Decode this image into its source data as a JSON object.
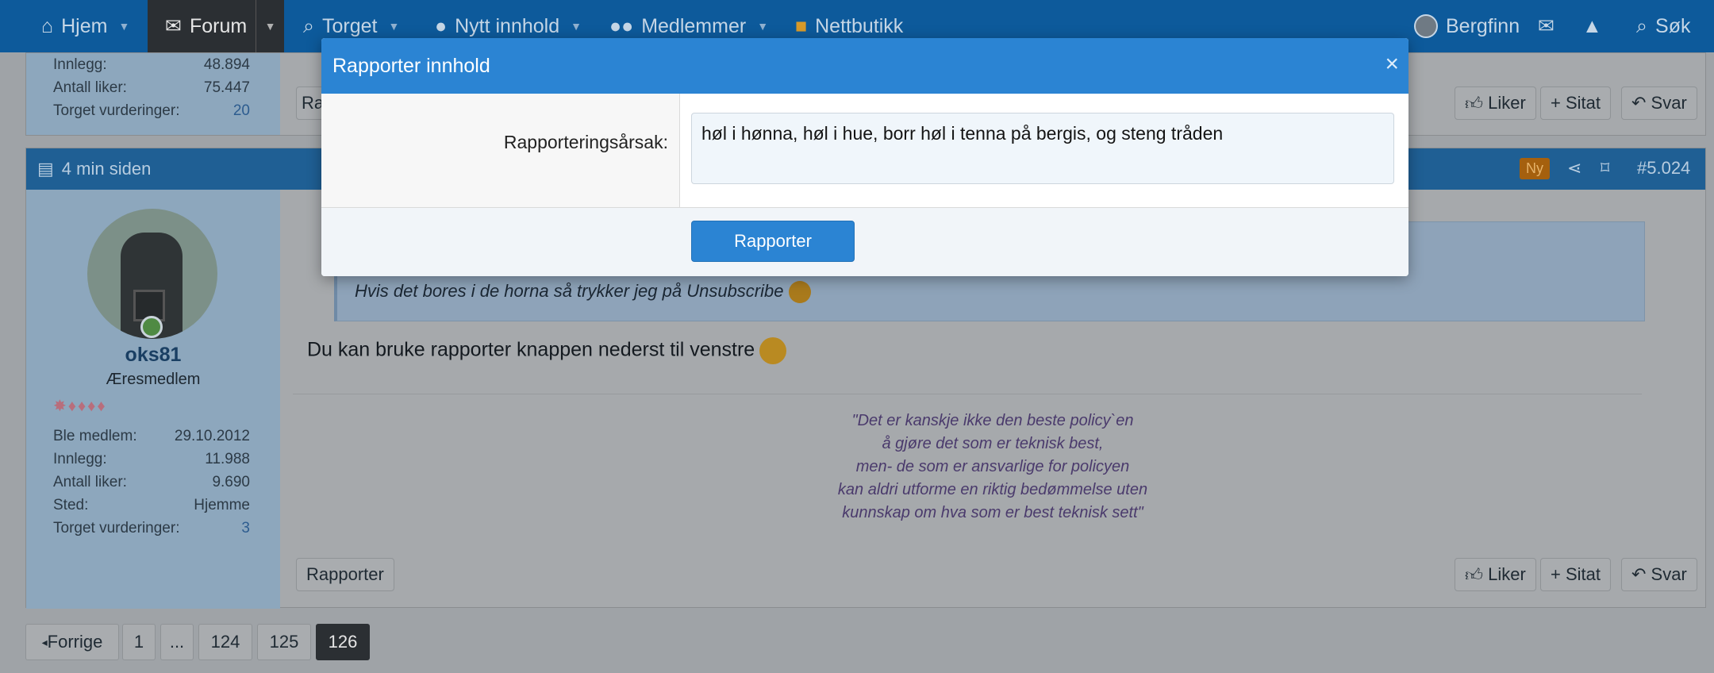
{
  "nav": {
    "home": "Hjem",
    "forum": "Forum",
    "torget": "Torget",
    "new_content": "Nytt innhold",
    "members": "Medlemmer",
    "shop": "Nettbutikk",
    "user": "Bergfinn",
    "search": "Søk"
  },
  "prev_post": {
    "stats": [
      {
        "label": "Innlegg:",
        "value": "48.894"
      },
      {
        "label": "Antall liker:",
        "value": "75.447"
      },
      {
        "label": "Torget vurderinger:",
        "value": "20"
      }
    ],
    "report_label_partial": "Ra",
    "like": "Liker",
    "quote": "Sitat",
    "reply": "Svar"
  },
  "post": {
    "time": "4 min siden",
    "badge_new": "Ny",
    "number": "#5.024",
    "username": "oks81",
    "user_title": "Æresmedlem",
    "stats": [
      {
        "label": "Ble medlem:",
        "value": "29.10.2012"
      },
      {
        "label": "Innlegg:",
        "value": "11.988"
      },
      {
        "label": "Antall liker:",
        "value": "9.690"
      },
      {
        "label": "Sted:",
        "value": "Hjemme"
      },
      {
        "label": "Torget vurderinger:",
        "value": "3"
      }
    ],
    "quote_text": "Hvis det bores i de horna så trykker jeg på Unsubscribe",
    "message": "Du kan bruke rapporter knappen nederst til venstre",
    "signature": [
      "\"Det er kanskje ikke den beste policy`en",
      "å gjøre det som er teknisk best,",
      "men- de som er ansvarlige for policyen",
      "kan aldri utforme en riktig bedømmelse uten",
      "kunnskap om hva som er best teknisk sett\""
    ],
    "report": "Rapporter",
    "like": "Liker",
    "quote": "Sitat",
    "reply": "Svar"
  },
  "pagination": {
    "prev": "Forrige",
    "pages": [
      "1",
      "...",
      "124",
      "125",
      "126"
    ],
    "current": "126"
  },
  "modal": {
    "title": "Rapporter innhold",
    "close": "×",
    "field_label": "Rapporteringsårsak:",
    "field_value": "høl i hønna, høl i hue, borr høl i tenna på bergis, og steng tråden",
    "submit": "Rapporter"
  },
  "colors": {
    "nav_bg": "#0d5a9b",
    "modal_accent": "#2b84d3",
    "badge_new": "#c5720f"
  },
  "icons": {
    "home": "home-icon",
    "forum": "comments-icon",
    "torget": "search-dollar-icon",
    "new_content": "lightbulb-icon",
    "members": "users-icon",
    "shop": "store-icon",
    "mail": "envelope-icon",
    "bell": "bell-icon",
    "search": "search-icon"
  }
}
